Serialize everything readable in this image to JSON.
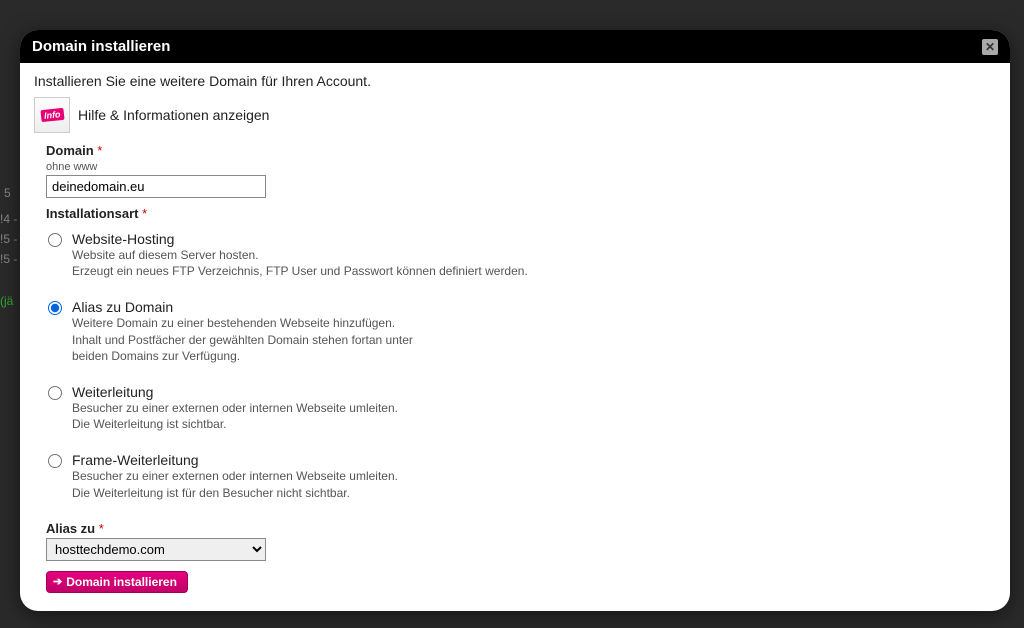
{
  "modal": {
    "title": "Domain installieren",
    "intro": "Installieren Sie eine weitere Domain für Ihren Account.",
    "help_link": "Hilfe & Informationen anzeigen",
    "info_badge": "Info"
  },
  "form": {
    "domain_label": "Domain",
    "domain_sub": "ohne www",
    "domain_value": "deinedomain.eu",
    "install_type_label": "Installationsart",
    "options": {
      "hosting": {
        "title": "Website-Hosting",
        "desc": "Website auf diesem Server hosten.\nErzeugt ein neues FTP Verzeichnis, FTP User und Passwort können definiert werden."
      },
      "alias": {
        "title": "Alias zu Domain",
        "desc": "Weitere Domain zu einer bestehenden Webseite hinzufügen.\nInhalt und Postfächer der gewählten Domain stehen fortan unter\nbeiden Domains zur Verfügung."
      },
      "redirect": {
        "title": "Weiterleitung",
        "desc": "Besucher zu einer externen oder internen Webseite umleiten.\nDie Weiterleitung ist sichtbar."
      },
      "frame": {
        "title": "Frame-Weiterleitung",
        "desc": "Besucher zu einer externen oder internen Webseite umleiten.\nDie Weiterleitung ist für den Besucher nicht sichtbar."
      }
    },
    "alias_label": "Alias zu",
    "alias_value": "hosttechdemo.com",
    "submit_label": "Domain installieren"
  },
  "background": {
    "frag1": "5",
    "frag2": "!4 -",
    "frag3": "!5 -",
    "frag4": "!5 -",
    "frag5": "(jä"
  }
}
